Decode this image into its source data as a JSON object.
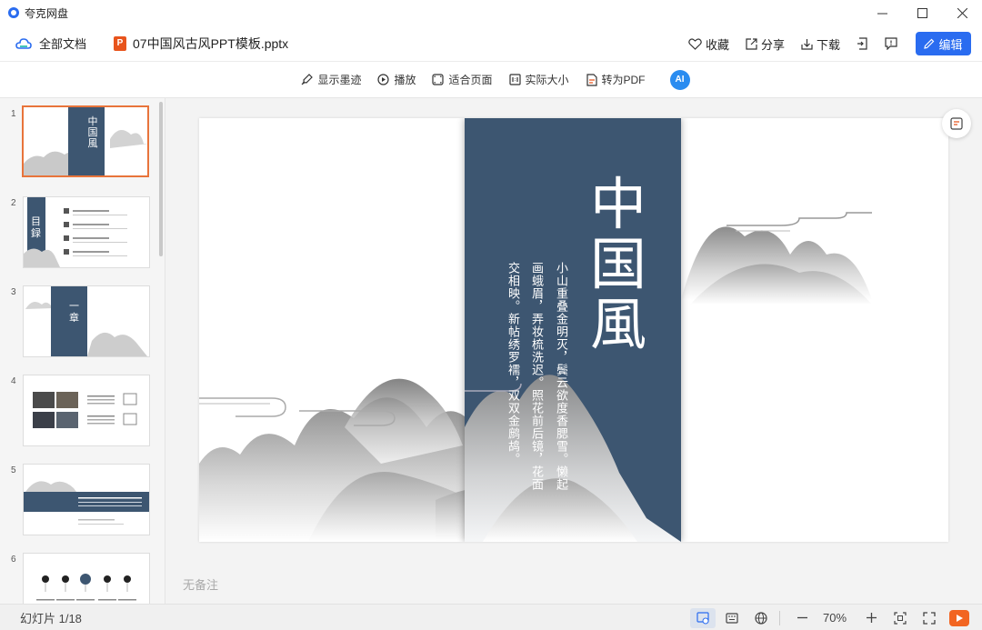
{
  "app": {
    "title": "夸克网盘"
  },
  "window": {
    "minimize": "—",
    "maximize": "☐",
    "close": "✕"
  },
  "docbar": {
    "all_docs": "全部文档",
    "file_name": "07中国风古风PPT模板.pptx",
    "ppt_badge": "P",
    "collect": "收藏",
    "share": "分享",
    "download": "下载",
    "edit": "编辑"
  },
  "toolbar": {
    "show_ink": "显示墨迹",
    "play": "播放",
    "fit_page": "适合页面",
    "actual_size": "实际大小",
    "to_pdf": "转为PDF",
    "ai": "AI"
  },
  "thumbnails": [
    {
      "num": "1",
      "title": "中国風"
    },
    {
      "num": "2",
      "title": "目録"
    },
    {
      "num": "3",
      "title": "一章"
    },
    {
      "num": "4",
      "title": ""
    },
    {
      "num": "5",
      "title": ""
    },
    {
      "num": "6",
      "title": ""
    }
  ],
  "slide": {
    "title": "中国風",
    "poem_lines": [
      "小山重叠金明灭，鬓云欲度香腮雪。懒起",
      "画蛾眉，弄妆梳洗迟。照花前后镜，花面",
      "交相映。新帖绣罗襦，双双金鹧鸪。"
    ]
  },
  "notes": "无备注",
  "status": {
    "slide_count": "幻灯片 1/18",
    "zoom": "70%",
    "zoom_out": "—",
    "zoom_in": "+"
  },
  "colors": {
    "accent": "#2a6cf0",
    "banner": "#3d5671",
    "ppt_orange": "#e8541c",
    "thumb_selected": "#e8743b"
  }
}
